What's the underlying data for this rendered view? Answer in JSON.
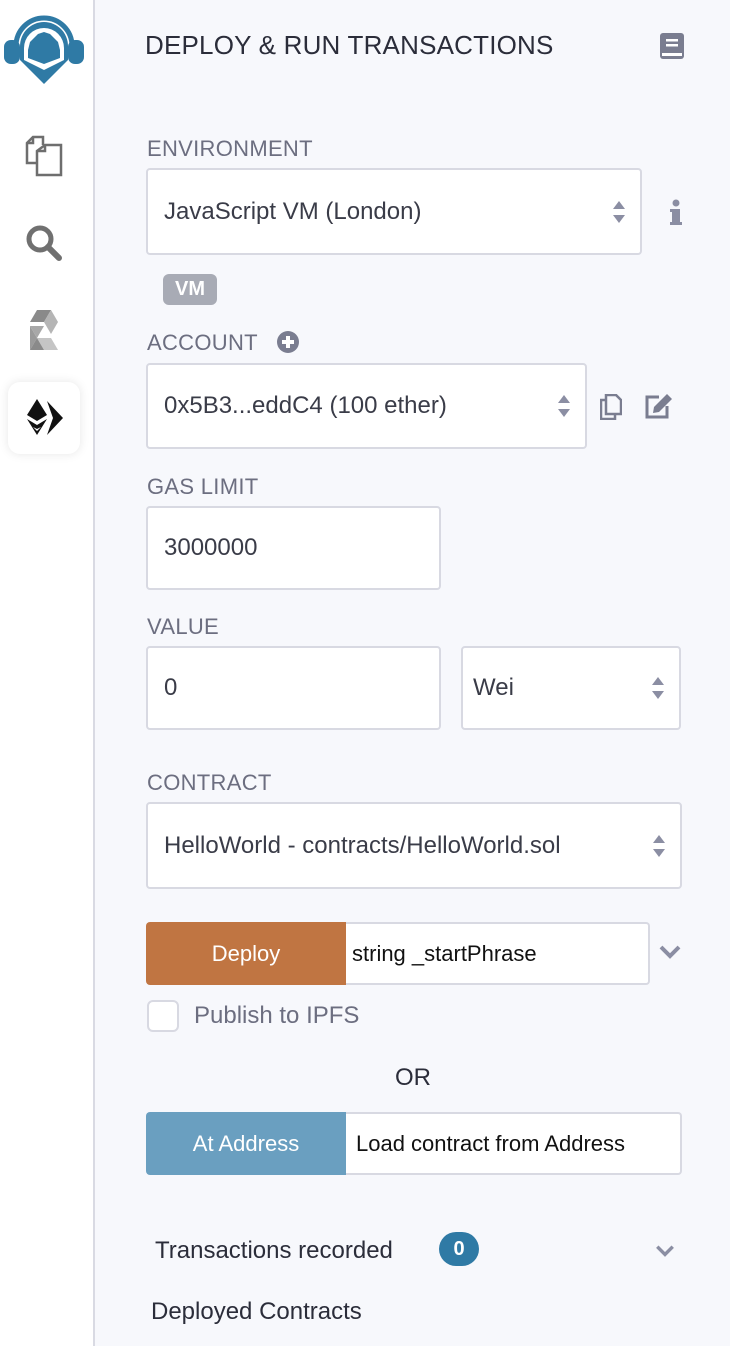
{
  "sidebar": {
    "items": [
      {
        "id": "logo",
        "icon": "remix-logo-icon"
      },
      {
        "id": "file-explorer",
        "icon": "files-icon"
      },
      {
        "id": "search",
        "icon": "search-icon"
      },
      {
        "id": "solidity-compiler",
        "icon": "solidity-icon"
      },
      {
        "id": "deploy-run",
        "icon": "ethereum-deploy-icon",
        "active": true
      }
    ]
  },
  "header": {
    "title": "DEPLOY & RUN TRANSACTIONS",
    "doc_icon": "book-icon"
  },
  "environment": {
    "label": "ENVIRONMENT",
    "value": "JavaScript VM (London)",
    "info_icon": "info-icon",
    "badge": "VM"
  },
  "account": {
    "label": "ACCOUNT",
    "add_icon": "plus-circle-icon",
    "value": "0x5B3...eddC4 (100 ether)",
    "copy_icon": "copy-icon",
    "edit_icon": "edit-icon"
  },
  "gas_limit": {
    "label": "GAS LIMIT",
    "value": "3000000"
  },
  "value": {
    "label": "VALUE",
    "amount": "0",
    "unit": "Wei"
  },
  "contract": {
    "label": "CONTRACT",
    "value": "HelloWorld - contracts/HelloWorld.sol"
  },
  "deploy": {
    "button_label": "Deploy",
    "param_placeholder": "string _startPhrase",
    "publish_label": "Publish to IPFS",
    "publish_checked": false
  },
  "or_label": "OR",
  "at_address": {
    "button_label": "At Address",
    "placeholder": "Load contract from Address"
  },
  "transactions": {
    "label": "Transactions recorded",
    "count": "0"
  },
  "deployed": {
    "label": "Deployed Contracts"
  },
  "colors": {
    "deploy_button": "#c07542",
    "at_address_button": "#6a9fc0",
    "badge_blue": "#2f7aa5",
    "logo_blue": "#2f7aa5"
  }
}
